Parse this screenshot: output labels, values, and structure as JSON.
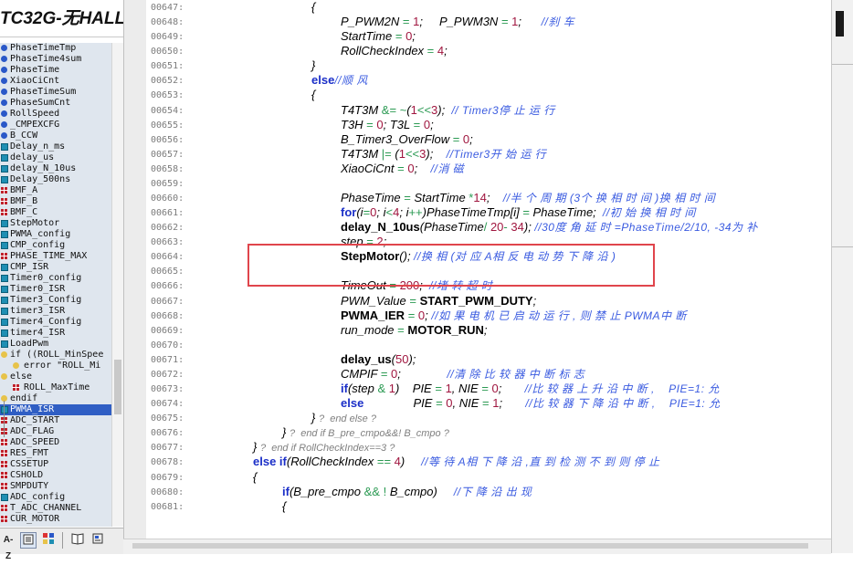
{
  "window_title": "TC32G-无HALL-",
  "symbols": [
    {
      "label": "PhaseTimeTmp",
      "icon": "function-icon",
      "kind": "fn"
    },
    {
      "label": "PhaseTime4sum",
      "icon": "function-icon",
      "kind": "fn"
    },
    {
      "label": "PhaseTime",
      "icon": "function-icon",
      "kind": "fn"
    },
    {
      "label": "XiaoCiCnt",
      "icon": "function-icon",
      "kind": "fn"
    },
    {
      "label": "PhaseTimeSum",
      "icon": "function-icon",
      "kind": "fn"
    },
    {
      "label": "PhaseSumCnt",
      "icon": "function-icon",
      "kind": "fn"
    },
    {
      "label": "RollSpeed",
      "icon": "function-icon",
      "kind": "fn"
    },
    {
      "label": "_CMPEXCFG",
      "icon": "function-icon",
      "kind": "fn"
    },
    {
      "label": "B_CCW",
      "icon": "function-icon",
      "kind": "fn"
    },
    {
      "label": "Delay_n_ms",
      "icon": "variable-icon",
      "kind": "var"
    },
    {
      "label": "delay_us",
      "icon": "variable-icon",
      "kind": "var"
    },
    {
      "label": "delay_N_10us",
      "icon": "variable-icon",
      "kind": "var"
    },
    {
      "label": "Delay_500ns",
      "icon": "variable-icon",
      "kind": "var"
    },
    {
      "label": "BMF_A",
      "icon": "macro-icon",
      "kind": "mac"
    },
    {
      "label": "BMF_B",
      "icon": "macro-icon",
      "kind": "mac"
    },
    {
      "label": "BMF_C",
      "icon": "macro-icon",
      "kind": "mac"
    },
    {
      "label": "StepMotor",
      "icon": "variable-icon",
      "kind": "var"
    },
    {
      "label": "PWMA_config",
      "icon": "variable-icon",
      "kind": "var"
    },
    {
      "label": "CMP_config",
      "icon": "variable-icon",
      "kind": "var"
    },
    {
      "label": "PHASE_TIME_MAX",
      "icon": "macro-icon",
      "kind": "mac"
    },
    {
      "label": "CMP_ISR",
      "icon": "variable-icon",
      "kind": "var"
    },
    {
      "label": "Timer0_config",
      "icon": "variable-icon",
      "kind": "var"
    },
    {
      "label": "Timer0_ISR",
      "icon": "variable-icon",
      "kind": "var"
    },
    {
      "label": "Timer3_Config",
      "icon": "variable-icon",
      "kind": "var"
    },
    {
      "label": "timer3_ISR",
      "icon": "variable-icon",
      "kind": "var"
    },
    {
      "label": "Timer4_Config",
      "icon": "variable-icon",
      "kind": "var"
    },
    {
      "label": "timer4_ISR",
      "icon": "variable-icon",
      "kind": "var"
    },
    {
      "label": "LoadPwm",
      "icon": "variable-icon",
      "kind": "var"
    },
    {
      "label": "if ((ROLL_MinSpee",
      "icon": "preprocessor-icon",
      "kind": "pre",
      "indent": 1
    },
    {
      "label": "error \"ROLL_Mi",
      "icon": "preprocessor-icon",
      "kind": "pre",
      "indent": 2
    },
    {
      "label": "else",
      "icon": "preprocessor-icon",
      "kind": "pre",
      "indent": 1
    },
    {
      "label": "ROLL_MaxTime",
      "icon": "macro-icon",
      "kind": "mac",
      "indent": 2
    },
    {
      "label": "endif",
      "icon": "preprocessor-icon",
      "kind": "pre",
      "indent": 1
    },
    {
      "label": "PWMA_ISR",
      "icon": "variable-icon",
      "kind": "var",
      "selected": true
    },
    {
      "label": "ADC_START",
      "icon": "macro-icon",
      "kind": "mac"
    },
    {
      "label": "ADC_FLAG",
      "icon": "macro-icon",
      "kind": "mac"
    },
    {
      "label": "ADC_SPEED",
      "icon": "macro-icon",
      "kind": "mac"
    },
    {
      "label": "RES_FMT",
      "icon": "macro-icon",
      "kind": "mac"
    },
    {
      "label": "CSSETUP",
      "icon": "macro-icon",
      "kind": "mac"
    },
    {
      "label": "CSHOLD",
      "icon": "macro-icon",
      "kind": "mac"
    },
    {
      "label": "SMPDUTY",
      "icon": "macro-icon",
      "kind": "mac"
    },
    {
      "label": "ADC_config",
      "icon": "variable-icon",
      "kind": "var"
    },
    {
      "label": "T_ADC_CHANNEL",
      "icon": "macro-icon",
      "kind": "mac"
    },
    {
      "label": "CUR_MOTOR",
      "icon": "macro-icon",
      "kind": "mac"
    }
  ],
  "bottom_tabs": {
    "az_label": "A-Z",
    "list_icon": "symbol-list-icon",
    "grid_icon": "symbol-grid-icon",
    "book_icon": "book-icon",
    "properties_icon": "properties-icon"
  },
  "code_lines": [
    {
      "num": "00647:",
      "indent": 205,
      "html": "{"
    },
    {
      "num": "00648:",
      "indent": 237,
      "html": "P_PWM2N <span class='op'>=</span> <span class='num'>1</span>;&nbsp;&nbsp;&nbsp;&nbsp; P_PWM3N <span class='op'>=</span> <span class='num'>1</span>;&nbsp;&nbsp;&nbsp;&nbsp;&nbsp; <span class='cm'>//刹 车</span>"
    },
    {
      "num": "00649:",
      "indent": 237,
      "html": "StartTime <span class='op'>=</span> <span class='num'>0</span>;"
    },
    {
      "num": "00650:",
      "indent": 237,
      "html": "RollCheckIndex <span class='op'>=</span> <span class='num'>4</span>;"
    },
    {
      "num": "00651:",
      "indent": 205,
      "html": "}"
    },
    {
      "num": "00652:",
      "indent": 205,
      "html": "<span class='kw'>else</span><span class='cm'>//顺 风</span>"
    },
    {
      "num": "00653:",
      "indent": 205,
      "html": "{"
    },
    {
      "num": "00654:",
      "indent": 237,
      "html": "T4T3M <span class='op'>&amp;=</span> <span class='op'>~</span>(<span class='num'>1</span><span class='op'>&lt;&lt;</span><span class='num'>3</span>);&nbsp; <span class='cm'>// Timer3停 止 运 行</span>"
    },
    {
      "num": "00655:",
      "indent": 237,
      "html": "T3H <span class='op'>=</span> <span class='num'>0</span>; T3L <span class='op'>=</span> <span class='num'>0</span>;"
    },
    {
      "num": "00656:",
      "indent": 237,
      "html": "B_Timer3_OverFlow <span class='op'>=</span> <span class='num'>0</span>;"
    },
    {
      "num": "00657:",
      "indent": 237,
      "html": "T4T3M <span class='op'>|=</span> (<span class='num'>1</span><span class='op'>&lt;&lt;</span><span class='num'>3</span>);&nbsp;&nbsp;&nbsp; <span class='cm'>//Timer3开 始 运 行</span>"
    },
    {
      "num": "00658:",
      "indent": 237,
      "html": "XiaoCiCnt <span class='op'>=</span> <span class='num'>0</span>;&nbsp;&nbsp;&nbsp; <span class='cm'>//消 磁</span>"
    },
    {
      "num": "00659:",
      "indent": 237,
      "html": ""
    },
    {
      "num": "00660:",
      "indent": 237,
      "html": "PhaseTime <span class='op'>=</span> StartTime <span class='op'>*</span><span class='num'>14</span>;&nbsp;&nbsp;&nbsp; <span class='cm'>//半 个 周 期 (3个 换 相 时 间 )换 相 时 间</span>"
    },
    {
      "num": "00661:",
      "indent": 237,
      "html": "<span class='kw'>for</span>(i<span class='op'>=</span><span class='num'>0</span>; i<span class='op'>&lt;</span><span class='num'>4</span>; i<span class='op'>++</span>)PhaseTimeTmp[i] <span class='op'>=</span> PhaseTime;&nbsp; <span class='cm'>//初 始 换 相 时 间</span>"
    },
    {
      "num": "00662:",
      "indent": 237,
      "html": "<span class='b'>delay_N_10us</span>(PhaseTime<span class='op'>/</span> <span class='num'>20</span><span class='op'>-</span> <span class='num'>34</span>); <span class='cm'>//30度 角 延 时 =PhaseTime/2/10, -34为 补</span>"
    },
    {
      "num": "00663:",
      "indent": 237,
      "html": "step <span class='op'>=</span> <span class='num'>2</span>;"
    },
    {
      "num": "00664:",
      "indent": 237,
      "html": "<span class='b'>StepMotor</span>(); <span class='cm'>//换 相 (对 应 A相 反 电 动 势 下 降 沿 )</span>"
    },
    {
      "num": "00665:",
      "indent": 237,
      "html": ""
    },
    {
      "num": "00666:",
      "indent": 237,
      "html": "TimeOut <span class='op'>=</span> <span class='num'>200</span>;&nbsp; <span class='cm'>//堵 转 超 时</span>"
    },
    {
      "num": "00667:",
      "indent": 237,
      "html": "PWM_Value <span class='op'>=</span> <span class='b'>START_PWM_DUTY</span>;"
    },
    {
      "num": "00668:",
      "indent": 237,
      "html": "<span class='b'>PWMA_IER</span> <span class='op'>=</span> <span class='num'>0</span>; <span class='cm'>//如 果 电 机 已 启 动 运 行 , 则 禁 止 PWMA中 断</span>"
    },
    {
      "num": "00669:",
      "indent": 237,
      "html": "run_mode <span class='op'>=</span> <span class='b'>MOTOR_RUN</span>;"
    },
    {
      "num": "00670:",
      "indent": 237,
      "html": ""
    },
    {
      "num": "00671:",
      "indent": 237,
      "html": "<span class='b'>delay_us</span>(<span class='num'>50</span>);"
    },
    {
      "num": "00672:",
      "indent": 237,
      "html": "CMPIF <span class='op'>=</span> <span class='num'>0</span>;&nbsp;&nbsp;&nbsp;&nbsp;&nbsp;&nbsp;&nbsp;&nbsp;&nbsp;&nbsp;&nbsp;&nbsp;&nbsp; <span class='cm'>//清 除 比 较 器 中 断 标 志</span>"
    },
    {
      "num": "00673:",
      "indent": 237,
      "html": "<span class='kw'>if</span>(step <span class='op'>&amp;</span> <span class='num'>1</span>)&nbsp;&nbsp;&nbsp; PIE <span class='op'>=</span> <span class='num'>1</span>, NIE <span class='op'>=</span> <span class='num'>0</span>;&nbsp;&nbsp;&nbsp;&nbsp;&nbsp;&nbsp; <span class='cm'>//比 较 器 上 升 沿 中 断 ,&nbsp;&nbsp;&nbsp; PIE=1: 允</span>"
    },
    {
      "num": "00674:",
      "indent": 237,
      "html": "<span class='kw'>else</span>&nbsp;&nbsp;&nbsp;&nbsp;&nbsp;&nbsp;&nbsp;&nbsp;&nbsp;&nbsp;&nbsp;&nbsp;&nbsp;&nbsp; PIE <span class='op'>=</span> <span class='num'>0</span>, NIE <span class='op'>=</span> <span class='num'>1</span>;&nbsp;&nbsp;&nbsp;&nbsp;&nbsp;&nbsp; <span class='cm'>//比 较 器 下 降 沿 中 断 ,&nbsp;&nbsp;&nbsp; PIE=1: 允</span>"
    },
    {
      "num": "00675:",
      "indent": 205,
      "html": "} <span class='gray'>?&nbsp; end else ?</span>"
    },
    {
      "num": "00676:",
      "indent": 173,
      "html": "} <span class='gray'>?&nbsp; end if B_pre_cmpo&amp;&amp;! B_cmpo ?</span>"
    },
    {
      "num": "00677:",
      "indent": 141,
      "html": "} <span class='gray'>?&nbsp; end if RollCheckIndex==3 ?</span>"
    },
    {
      "num": "00678:",
      "indent": 141,
      "html": "<span class='kw'>else if</span>(RollCheckIndex <span class='op'>==</span> <span class='num'>4</span>)&nbsp;&nbsp;&nbsp;&nbsp; <span class='cm'>//等 待 A相 下 降 沿 ,直 到 检 测 不 到 则 停 止</span>"
    },
    {
      "num": "00679:",
      "indent": 141,
      "html": "{"
    },
    {
      "num": "00680:",
      "indent": 173,
      "html": "<span class='kw'>if</span>(B_pre_cmpo <span class='op'>&amp;&amp;</span> <span class='op'>!</span> B_cmpo)&nbsp;&nbsp;&nbsp;&nbsp; <span class='cm'>//下 降 沿 出 现</span>"
    },
    {
      "num": "00681:",
      "indent": 173,
      "html": "{"
    }
  ]
}
